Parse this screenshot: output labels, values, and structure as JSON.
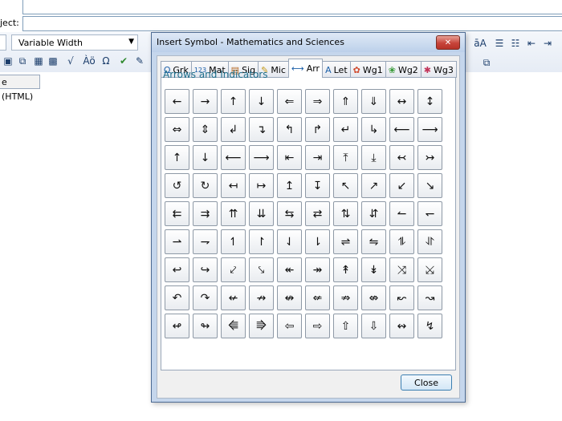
{
  "background": {
    "subject_label": "ject:",
    "font_select_value": "Variable Width",
    "document_tab": "e (HTML)"
  },
  "dialog": {
    "title": "Insert Symbol - Mathematics and Sciences",
    "close_x": "✕",
    "tabs": [
      {
        "icon": "Ω",
        "label": "Grk",
        "color": "#1b5fa8"
      },
      {
        "icon": "123",
        "label": "Mat",
        "color": "#1b5fa8"
      },
      {
        "icon": "▤",
        "label": "Sig",
        "color": "#b5651d"
      },
      {
        "icon": "✎",
        "label": "Mic",
        "color": "#c69a1a"
      },
      {
        "icon": "⟷",
        "label": "Arr",
        "color": "#1b5fa8"
      },
      {
        "icon": "A",
        "label": "Let",
        "color": "#1b5fa8"
      },
      {
        "icon": "✿",
        "label": "Wg1",
        "color": "#d04a2e"
      },
      {
        "icon": "❀",
        "label": "Wg2",
        "color": "#3a9b3a"
      },
      {
        "icon": "✱",
        "label": "Wg3",
        "color": "#c2345a"
      }
    ],
    "active_tab_index": 4,
    "section_title": "Arrows and Indicators",
    "symbols": [
      "←",
      "→",
      "↑",
      "↓",
      "⇐",
      "⇒",
      "⇑",
      "⇓",
      "↔",
      "↕",
      "⇔",
      "⇕",
      "↲",
      "↴",
      "↰",
      "↱",
      "↵",
      "↳",
      "⟵",
      "⟶",
      "↑",
      "↓",
      "⟵",
      "⟶",
      "⇤",
      "⇥",
      "⤒",
      "⤓",
      "↢",
      "↣",
      "↺",
      "↻",
      "↤",
      "↦",
      "↥",
      "↧",
      "↖",
      "↗",
      "↙",
      "↘",
      "⇇",
      "⇉",
      "⇈",
      "⇊",
      "⇆",
      "⇄",
      "⇅",
      "⇵",
      "↼",
      "↽",
      "⇀",
      "⇁",
      "↿",
      "↾",
      "⇃",
      "⇂",
      "⇌",
      "⇋",
      "⥮",
      "⥯",
      "↩",
      "↪",
      "⤦",
      "⤥",
      "↞",
      "↠",
      "↟",
      "↡",
      "⤨",
      "⤩",
      "↶",
      "↷",
      "↚",
      "↛",
      "↮",
      "⇍",
      "⇏",
      "⇎",
      "↜",
      "↝",
      "↫",
      "↬",
      "⭅",
      "⭆",
      "⇦",
      "⇨",
      "⇧",
      "⇩",
      "↭",
      "↯"
    ],
    "close_button": "Close"
  }
}
